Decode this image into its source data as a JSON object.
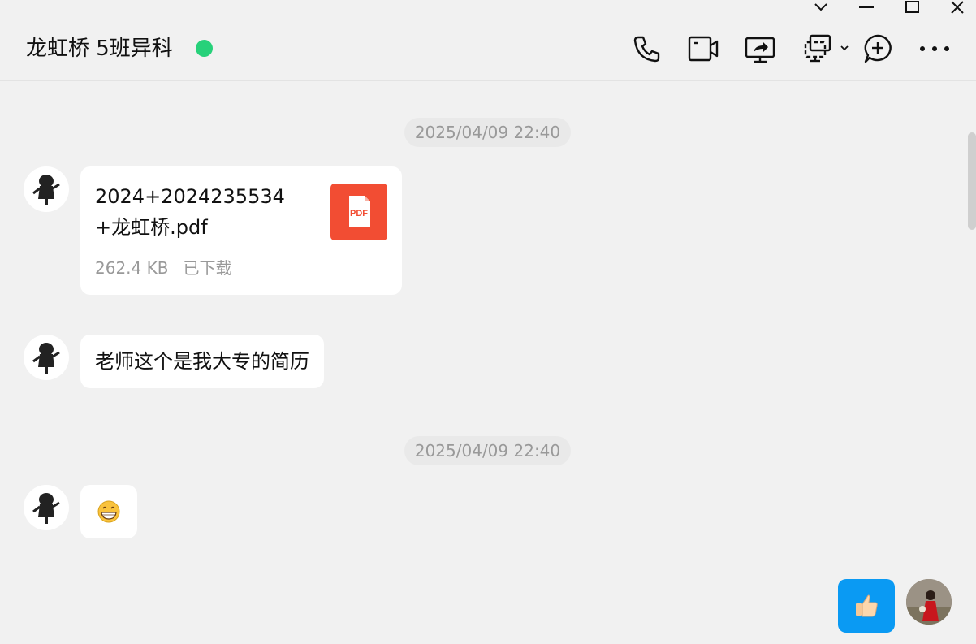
{
  "header": {
    "chat_title": "龙虹桥 5班异科",
    "online_color": "#27d17a"
  },
  "window_controls": [
    "chevron-down-icon",
    "minimize-icon",
    "maximize-icon",
    "close-icon"
  ],
  "toolbar": [
    "phone-icon",
    "video-icon",
    "screen-share-icon",
    "remote-assist-icon",
    "add-chat-icon",
    "more-icon"
  ],
  "messages": [
    {
      "type": "timestamp",
      "text": "2025/04/09 22:40"
    },
    {
      "type": "file",
      "file_name": "2024+2024235534+龙虹桥.pdf",
      "size": "262.4 KB",
      "status": "已下载",
      "file_type": "PDF"
    },
    {
      "type": "text",
      "text": "老师这个是我大专的简历"
    },
    {
      "type": "timestamp",
      "text": "2025/04/09 22:40"
    },
    {
      "type": "emoji",
      "emoji": "grinning-face-emoji"
    },
    {
      "type": "self-emoji",
      "emoji": "thumbs-up-emoji"
    }
  ],
  "colors": {
    "self_bubble": "#0a9af3",
    "pdf_badge": "#f24d33",
    "background": "#f1f1f1"
  }
}
